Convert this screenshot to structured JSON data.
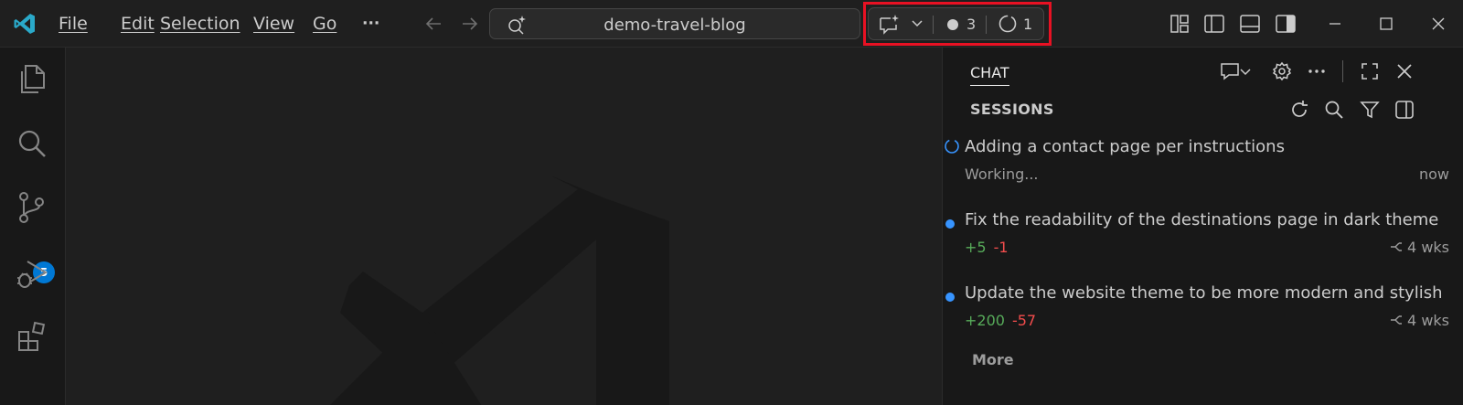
{
  "menu": {
    "file": "File",
    "edit": "Edit",
    "selection": "Selection",
    "view": "View",
    "go": "Go",
    "more": "···"
  },
  "command_center": {
    "text": "demo-travel-blog"
  },
  "chat_status": {
    "sessions_count": "3",
    "in_progress_count": "1"
  },
  "activity_bar": {
    "source_control_badge": "5"
  },
  "chat_panel": {
    "tab_label": "CHAT",
    "sessions_title": "SESSIONS",
    "sessions": [
      {
        "title": "Adding a contact page per instructions",
        "status": "Working...",
        "time": "now",
        "state": "running"
      },
      {
        "title": "Fix the readability of the destinations page in dark theme",
        "added": "+5",
        "removed": "-1",
        "time": "4 wks",
        "state": "done"
      },
      {
        "title": "Update the website theme to be more modern and stylish",
        "added": "+200",
        "removed": "-57",
        "time": "4 wks",
        "state": "done"
      }
    ],
    "more_label": "More"
  },
  "colors": {
    "accent": "#3794ff",
    "highlight": "#e81123",
    "added": "#57ab5a",
    "removed": "#f14c4c",
    "badge": "#0078d4"
  },
  "icons": {
    "app_logo": "vscode-logo-icon",
    "activity": [
      "explorer-icon",
      "search-icon",
      "source-control-icon",
      "run-debug-icon",
      "extensions-icon"
    ]
  }
}
